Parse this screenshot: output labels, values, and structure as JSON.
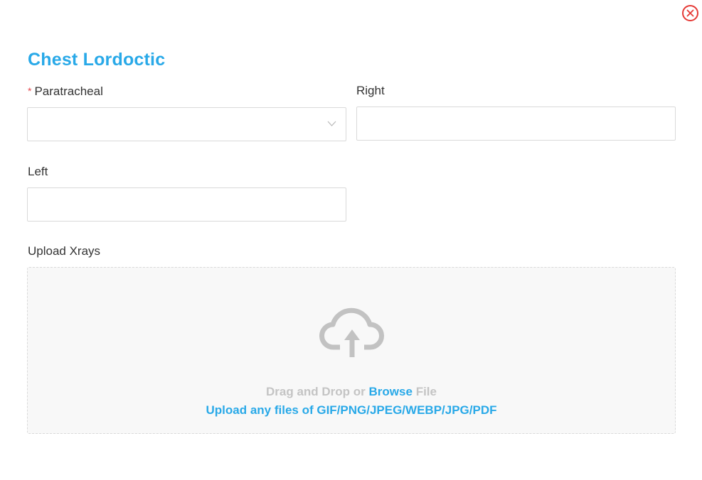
{
  "modal": {
    "title": "Chest Lordoctic"
  },
  "form": {
    "paratracheal": {
      "label": "Paratracheal",
      "required_mark": "*",
      "value": ""
    },
    "right": {
      "label": "Right",
      "value": ""
    },
    "left": {
      "label": "Left",
      "value": ""
    },
    "upload": {
      "label": "Upload Xrays",
      "drag_text": "Drag and Drop or",
      "browse_text": "Browse",
      "file_text": "File",
      "hint": "Upload any files of GIF/PNG/JPEG/WEBP/JPG/PDF"
    }
  },
  "icons": {
    "close": "close-circle-icon",
    "chevron": "chevron-down-icon",
    "upload": "cloud-upload-icon"
  },
  "colors": {
    "accent": "#29a9e8",
    "close": "#e53935",
    "required": "#e5484d",
    "muted": "#c4c4c4"
  }
}
